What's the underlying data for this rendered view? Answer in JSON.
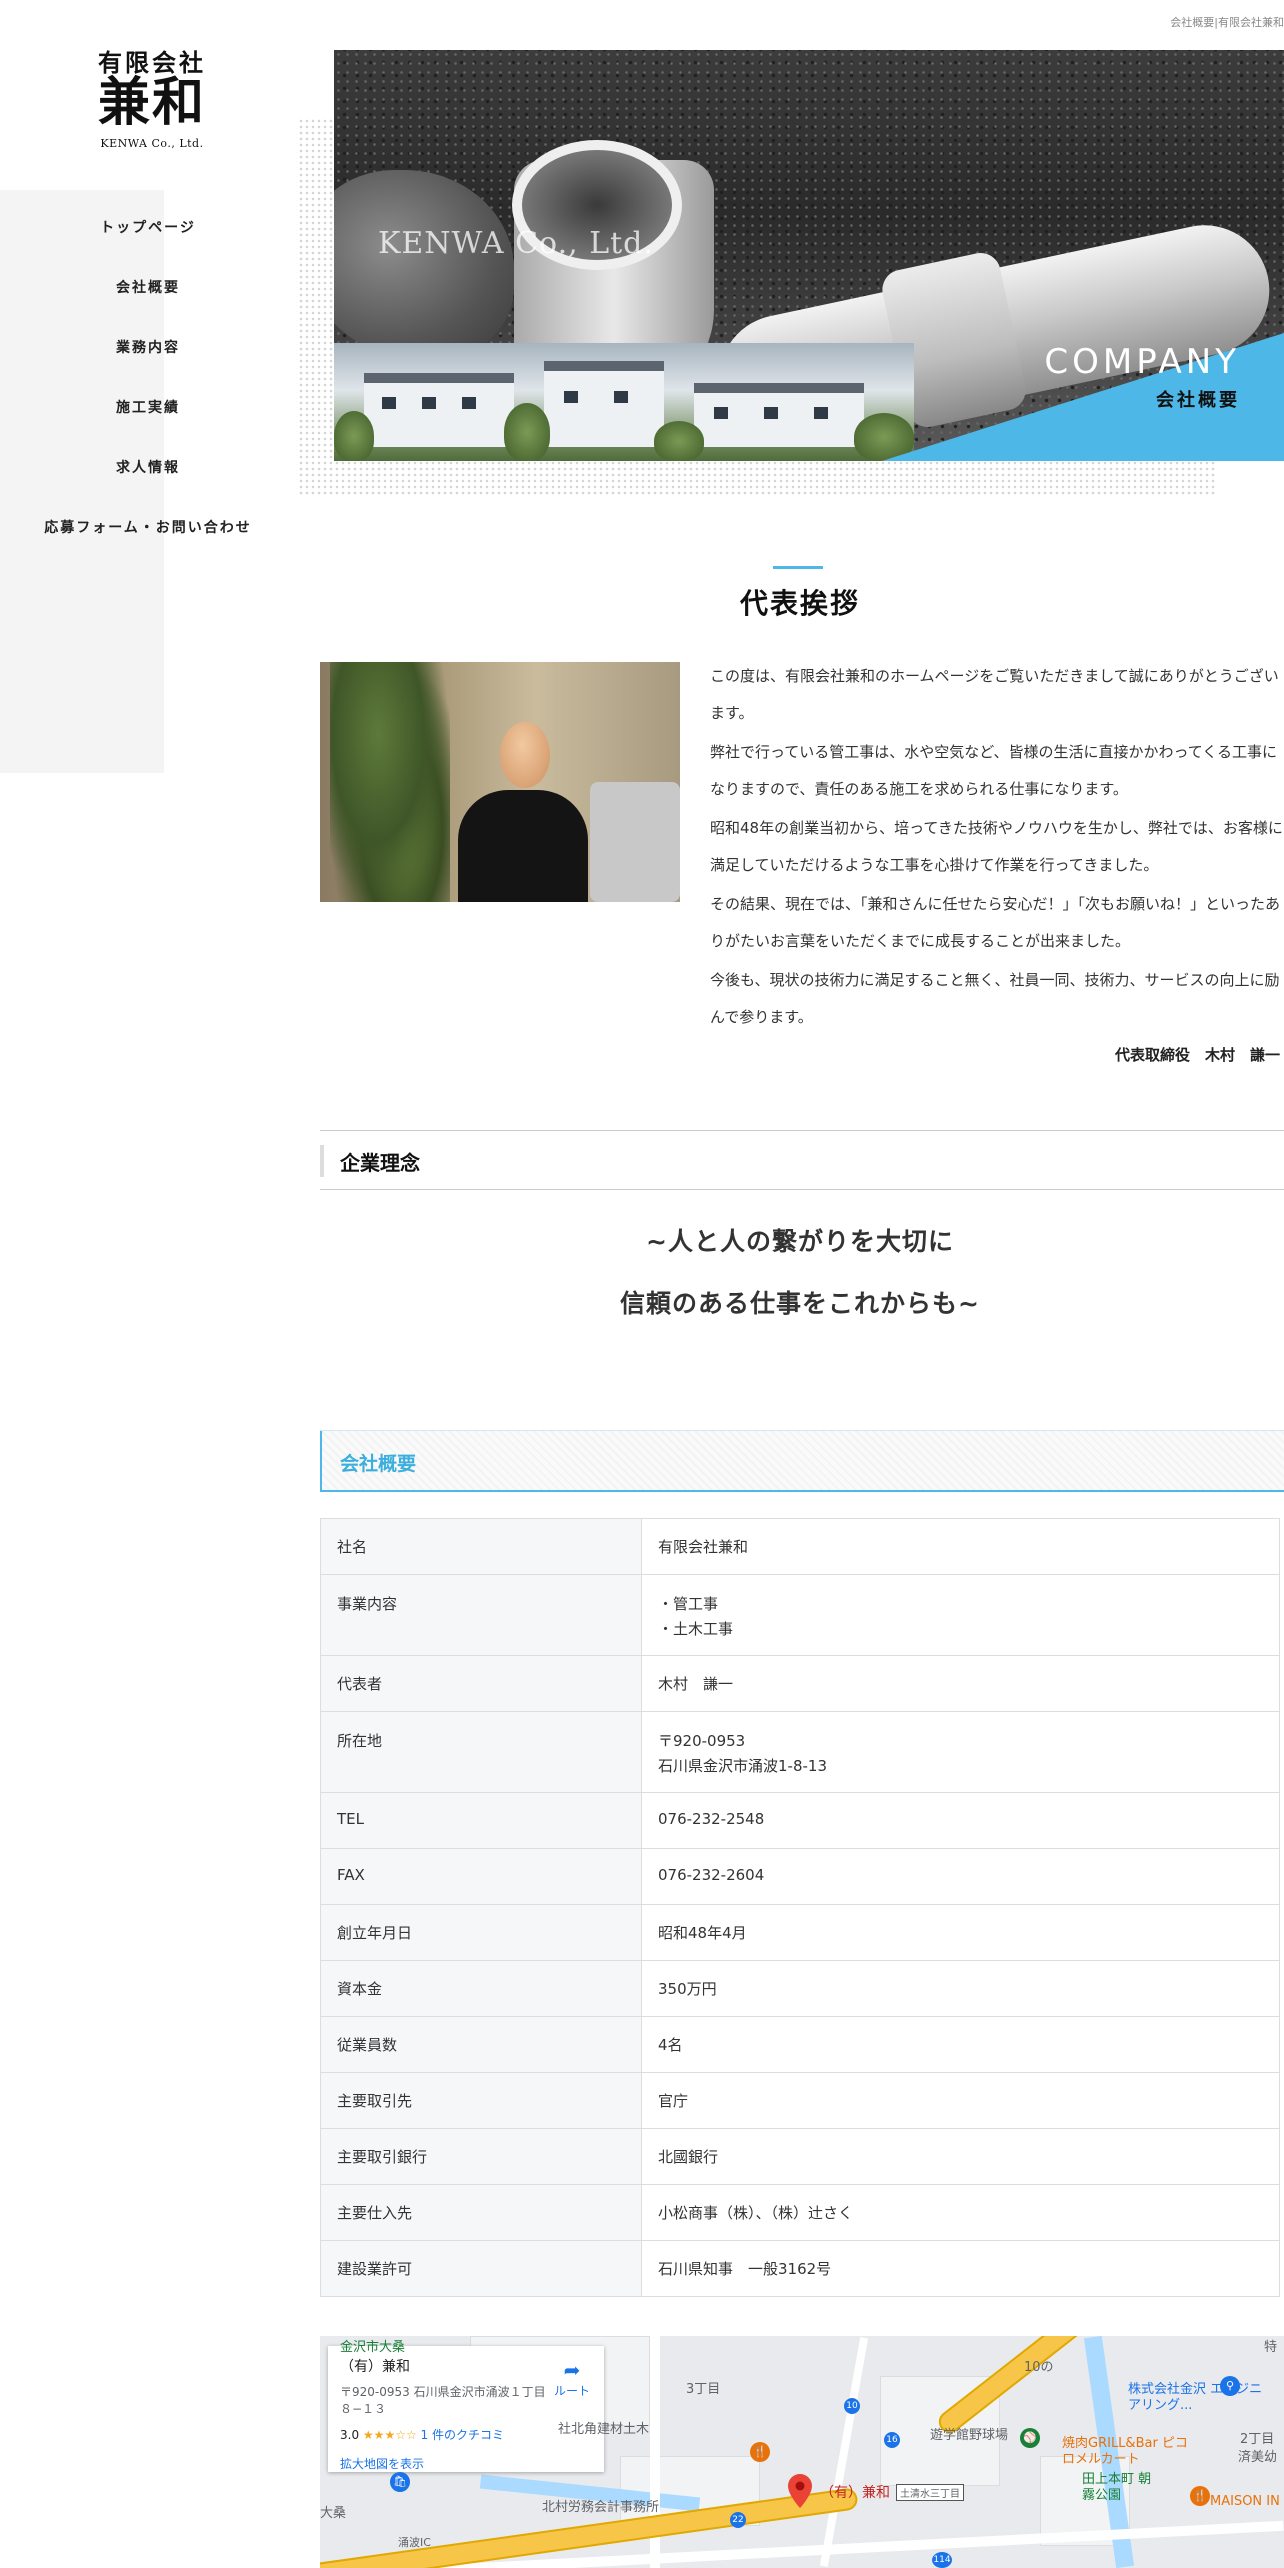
{
  "breadcrumb": "会社概要|有限会社兼和",
  "logo": {
    "small": "有限会社",
    "big": "兼和",
    "en": "KENWA Co., Ltd."
  },
  "nav": [
    {
      "label": "トップページ"
    },
    {
      "label": "会社概要"
    },
    {
      "label": "業務内容"
    },
    {
      "label": "施工実績"
    },
    {
      "label": "求人情報"
    },
    {
      "label": "応募フォーム・お問い合わせ"
    }
  ],
  "hero": {
    "en_name": "KENWA Co., Ltd.",
    "title": "COMPANY",
    "subtitle": "会社概要"
  },
  "greeting": {
    "title": "代表挨拶",
    "paragraphs": [
      "この度は、有限会社兼和のホームページをご覧いただきまして誠にありがとうございます。",
      "弊社で行っている管工事は、水や空気など、皆様の生活に直接かかわってくる工事になりますので、責任のある施工を求められる仕事になります。",
      "昭和48年の創業当初から、培ってきた技術やノウハウを生かし、弊社では、お客様に満足していただけるような工事を心掛けて作業を行ってきました。",
      "その結果、現在では、「兼和さんに任せたら安心だ！」「次もお願いね！」といったありがたいお言葉をいただくまでに成長することが出来ました。",
      "今後も、現状の技術力に満足すること無く、社員一同、技術力、サービスの向上に励んで参ります。"
    ],
    "signature": "代表取締役　木村　謙一"
  },
  "philosophy": {
    "heading": "企業理念",
    "line1": "~人と人の繋がりを大切に",
    "line2": "信頼のある仕事をこれからも~"
  },
  "overview": {
    "heading": "会社概要",
    "rows": [
      {
        "key": "社名",
        "v1": "有限会社兼和",
        "v2": ""
      },
      {
        "key": "事業内容",
        "v1": "・管工事",
        "v2": "・土木工事"
      },
      {
        "key": "代表者",
        "v1": "木村　謙一",
        "v2": ""
      },
      {
        "key": "所在地",
        "v1": "〒920-0953",
        "v2": "石川県金沢市涌波1-8-13"
      },
      {
        "key": "TEL",
        "v1": "076-232-2548",
        "v2": ""
      },
      {
        "key": "FAX",
        "v1": "076-232-2604",
        "v2": ""
      },
      {
        "key": "創立年月日",
        "v1": "昭和48年4月",
        "v2": ""
      },
      {
        "key": "資本金",
        "v1": "350万円",
        "v2": ""
      },
      {
        "key": "従業員数",
        "v1": "4名",
        "v2": ""
      },
      {
        "key": "主要取引先",
        "v1": "官庁",
        "v2": ""
      },
      {
        "key": "主要取引銀行",
        "v1": "北國銀行",
        "v2": ""
      },
      {
        "key": "主要仕入先",
        "v1": "小松商事（株）、（株）辻さく",
        "v2": ""
      },
      {
        "key": "建設業許可",
        "v1": "石川県知事　一般3162号",
        "v2": ""
      }
    ]
  },
  "map": {
    "place_name": "（有）兼和",
    "address": "〒920-0953 石川県金沢市涌波１丁目８−１３",
    "rating": "3.0",
    "stars": "★★★☆☆",
    "reviews": "1 件のクチコミ",
    "route": "ルート",
    "enlarge": "拡大地図を表示",
    "pin_label": "（有）兼和",
    "labels": {
      "kanazawa_top": "金沢市大桑",
      "chome3": "3丁目",
      "kitakado": "社北角建材土木",
      "kitamura": "北村労務会計事務所",
      "oguwa": "大桑",
      "wakunami_ic": "涌波IC",
      "stadium": "遊学館野球場",
      "engineering": "株式会社金沢 エンジニアリング...",
      "grill": "焼肉GRILL&Bar ピコロメルカート",
      "park": "田上本町 朝霧公園",
      "maison": "MAISON IN",
      "juko": "10の",
      "chome2": "2丁目",
      "saibi": "済美幼",
      "tokubetsu": "特",
      "tsuchishimizu": "土清水三丁目",
      "route10": "10",
      "route22": "22",
      "route114": "114",
      "route16": "16"
    }
  }
}
